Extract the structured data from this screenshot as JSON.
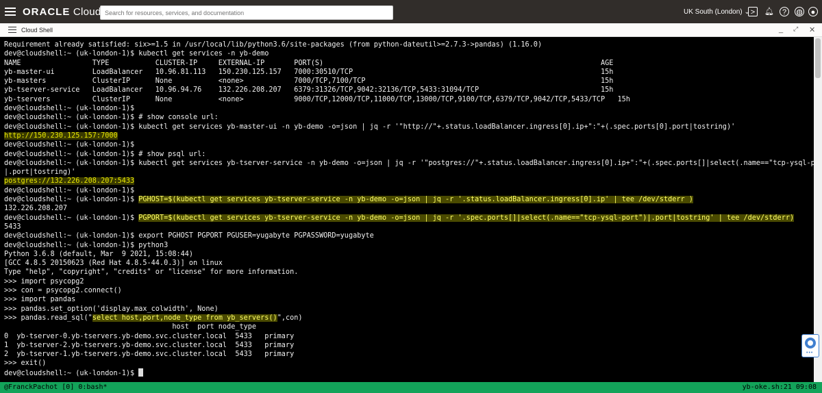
{
  "header": {
    "brand": "ORACLE",
    "product": "Cloud",
    "search_placeholder": "Search for resources, services, and documentation",
    "region": "UK South (London)"
  },
  "shell": {
    "title": "Cloud Shell"
  },
  "terminal": {
    "lines": [
      {
        "segments": [
          {
            "t": "Requirement already satisfied: six>=1.5 in /usr/local/lib/python3.6/site-packages (from python-dateutil>=2.7.3->pandas) (1.16.0)"
          }
        ]
      },
      {
        "segments": [
          {
            "t": "dev@cloudshell:~ (uk-london-1)$ kubectl get services -n yb-demo"
          }
        ]
      },
      {
        "segments": [
          {
            "t": "NAME                 TYPE           CLUSTER-IP     EXTERNAL-IP       PORT(S)                                                                  AGE"
          }
        ]
      },
      {
        "segments": [
          {
            "t": "yb-master-ui         LoadBalancer   10.96.81.113   150.230.125.157   7000:30510/TCP                                                           15h"
          }
        ]
      },
      {
        "segments": [
          {
            "t": "yb-masters           ClusterIP      None           <none>            7000/TCP,7100/TCP                                                        15h"
          }
        ]
      },
      {
        "segments": [
          {
            "t": "yb-tserver-service   LoadBalancer   10.96.94.76    132.226.208.207   6379:31326/TCP,9042:32136/TCP,5433:31094/TCP                             15h"
          }
        ]
      },
      {
        "segments": [
          {
            "t": "yb-tservers          ClusterIP      None           <none>            9000/TCP,12000/TCP,11000/TCP,13000/TCP,9100/TCP,6379/TCP,9042/TCP,5433/TCP   15h"
          }
        ]
      },
      {
        "segments": [
          {
            "t": "dev@cloudshell:~ (uk-london-1)$"
          }
        ]
      },
      {
        "segments": [
          {
            "t": "dev@cloudshell:~ (uk-london-1)$ # show console url:"
          }
        ]
      },
      {
        "segments": [
          {
            "t": "dev@cloudshell:~ (uk-london-1)$ kubectl get services yb-master-ui -n yb-demo -o=json | jq -r '\"http://\"+.status.loadBalancer.ingress[0].ip+\":\"+(.spec.ports[0].port|tostring)'"
          }
        ]
      },
      {
        "segments": [
          {
            "t": "http://150.230.125.157:7000",
            "hl": "g"
          }
        ]
      },
      {
        "segments": [
          {
            "t": "dev@cloudshell:~ (uk-london-1)$"
          }
        ]
      },
      {
        "segments": [
          {
            "t": "dev@cloudshell:~ (uk-london-1)$ # show psql url:"
          }
        ]
      },
      {
        "segments": [
          {
            "t": "dev@cloudshell:~ (uk-london-1)$ kubectl get services yb-tserver-service -n yb-demo -o=json | jq -r '\"postgres://\"+.status.loadBalancer.ingress[0].ip+\":\"+(.spec.ports[]|select(.name==\"tcp-ysql-port\")"
          }
        ]
      },
      {
        "segments": [
          {
            "t": "|.port|tostring)'"
          }
        ]
      },
      {
        "segments": [
          {
            "t": "postgres://132.226.208.207:5433",
            "hl": "g"
          }
        ]
      },
      {
        "segments": [
          {
            "t": "dev@cloudshell:~ (uk-london-1)$"
          }
        ]
      },
      {
        "segments": [
          {
            "t": "dev@cloudshell:~ (uk-london-1)$ "
          },
          {
            "t": "PGHOST=$(kubectl get services yb-tserver-service -n yb-demo -o=json | jq -r '.status.loadBalancer.ingress[0].ip' | tee /dev/stderr )",
            "hl": "y"
          }
        ]
      },
      {
        "segments": [
          {
            "t": "132.226.208.207"
          }
        ]
      },
      {
        "segments": [
          {
            "t": "dev@cloudshell:~ (uk-london-1)$ "
          },
          {
            "t": "PGPORT=$(kubectl get services yb-tserver-service -n yb-demo -o=json | jq -r '.spec.ports[]|select(.name==\"tcp-ysql-port\")|.port|tostring' | tee /dev/stderr)",
            "hl": "y"
          }
        ]
      },
      {
        "segments": [
          {
            "t": "5433"
          }
        ]
      },
      {
        "segments": [
          {
            "t": "dev@cloudshell:~ (uk-london-1)$ export PGHOST PGPORT PGUSER=yugabyte PGPASSWORD=yugabyte"
          }
        ]
      },
      {
        "segments": [
          {
            "t": "dev@cloudshell:~ (uk-london-1)$ python3"
          }
        ]
      },
      {
        "segments": [
          {
            "t": "Python 3.6.8 (default, Mar  9 2021, 15:08:44)"
          }
        ]
      },
      {
        "segments": [
          {
            "t": "[GCC 4.8.5 20150623 (Red Hat 4.8.5-44.0.3)] on linux"
          }
        ]
      },
      {
        "segments": [
          {
            "t": "Type \"help\", \"copyright\", \"credits\" or \"license\" for more information."
          }
        ]
      },
      {
        "segments": [
          {
            "t": ">>> import psycopg2"
          }
        ]
      },
      {
        "segments": [
          {
            "t": ">>> con = psycopg2.connect()"
          }
        ]
      },
      {
        "segments": [
          {
            "t": ">>> import pandas"
          }
        ]
      },
      {
        "segments": [
          {
            "t": ">>> pandas.set_option('display.max_colwidth', None)"
          }
        ]
      },
      {
        "segments": [
          {
            "t": ">>> pandas.read_sql(\""
          },
          {
            "t": "select host,port,node_type from yb_servers()",
            "hl": "y"
          },
          {
            "t": "\",con)"
          }
        ]
      },
      {
        "segments": [
          {
            "t": "                                        host  port node_type"
          }
        ]
      },
      {
        "segments": [
          {
            "t": "0  yb-tserver-0.yb-tservers.yb-demo.svc.cluster.local  5433   primary"
          }
        ]
      },
      {
        "segments": [
          {
            "t": "1  yb-tserver-2.yb-tservers.yb-demo.svc.cluster.local  5433   primary"
          }
        ]
      },
      {
        "segments": [
          {
            "t": "2  yb-tserver-1.yb-tservers.yb-demo.svc.cluster.local  5433   primary"
          }
        ]
      },
      {
        "segments": [
          {
            "t": ">>> exit()"
          }
        ]
      },
      {
        "segments": [
          {
            "t": "dev@cloudshell:~ (uk-london-1)$ "
          }
        ],
        "cursor": true
      }
    ]
  },
  "status_bar": {
    "left": " @FranckPachot [0]  0:bash*",
    "right": "yb-oke.sh:21 09:08"
  },
  "colors": {
    "status_bg": "#13a35a",
    "highlight": "#ffff66"
  }
}
